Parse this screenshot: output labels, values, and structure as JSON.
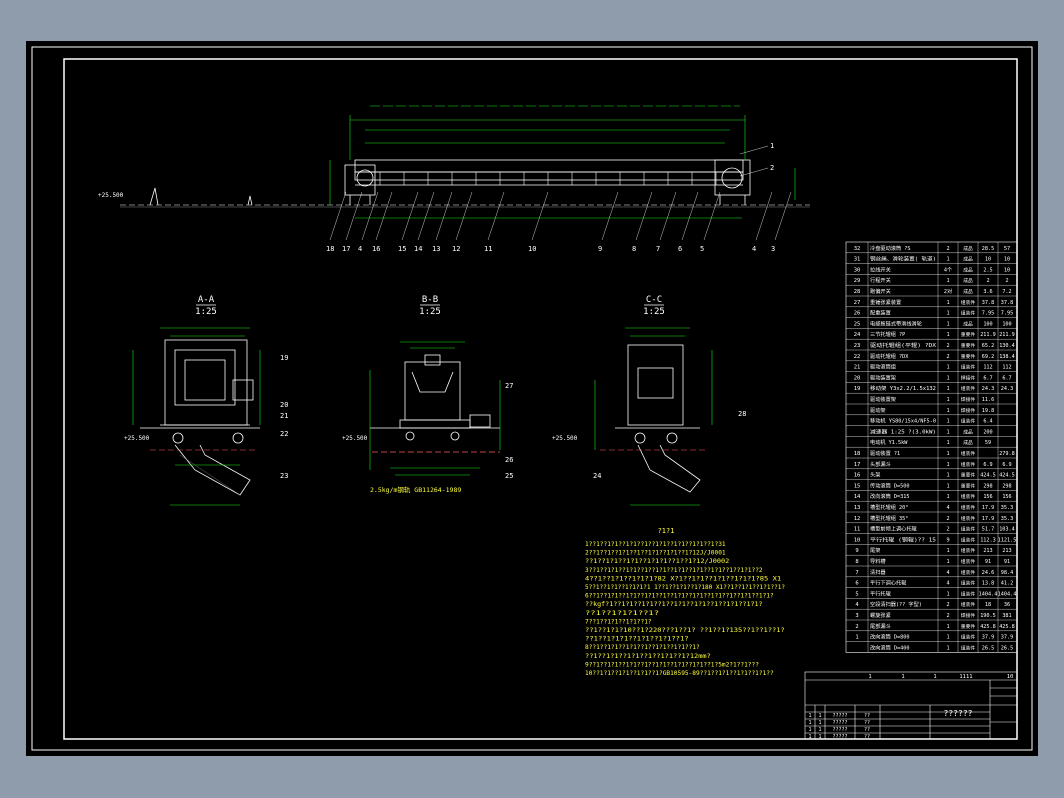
{
  "colors": {
    "backdrop": "#8f9cab",
    "sheet": "#000000",
    "frame": "#ffffff",
    "drawing": "#ffffff",
    "dims": "#19e619",
    "table_text": "#ffffff",
    "accent": "#ff5a5a",
    "notes": "#ffff3c"
  },
  "views": {
    "section_a": {
      "title": "A-A",
      "scale": "1:25"
    },
    "section_b": {
      "title": "B-B",
      "scale": "1:25"
    },
    "section_c": {
      "title": "C-C",
      "scale": "1:25"
    }
  },
  "elevation_label": "+25.500",
  "section_note": "2.5kg/m钢轨 GB11264-1989",
  "callouts_bottom": [
    "18",
    "17",
    "4",
    "16",
    "15",
    "14",
    "13",
    "12",
    "11",
    "10",
    "9",
    "8",
    "7",
    "6",
    "5",
    "4",
    "3"
  ],
  "callouts_side": [
    "1",
    "2"
  ],
  "callouts_a": [
    "19",
    "20",
    "21",
    "22",
    "23"
  ],
  "callouts_b": [
    "27",
    "26",
    "25"
  ],
  "callouts_c": [
    "28",
    "24"
  ],
  "notes": {
    "heading": "?1?1",
    "lines": [
      "1??1??1?1??1?1??1??1?1??1?1??1?1??1?31",
      "2??1??1??1?1??1??1?1??1?1??1?12J/J0001",
      "    ??1??1?1??1?1??1?1?1??1??1?12/J0002",
      "3??1??1?1??1?1??1??1?1??1?1??1?1??1?1??1??1?1??2",
      "4??1??1?1??1?1?1?82    X?1??1?1??1?1??1?1?1?85     X1",
      "5??1??1?1??1?1?1?1     1??1??1?1??1?180     X1??1??1?1??1?1??1?",
      "6??1??1?1??1?1??1?1??1??1?1??1?1??1?1??1??1?1??1?1?",
      "    ??kgf?1??1?1??1?1??1??1?1??1?1??1??1?1??1?1?",
      "      ??1??1?1?1??1?",
      "7??1??1?1??1?1??1?",
      "    ??1??1?1?10??1?220???1??1?    ??1??1?135??1??1??1?",
      "    ??1??1?1?1??1?1??1?1??1?",
      "8??1??1?1??1?1??1??1?1??1?1??1?",
      "    ??1??1?1??1?1??1??1?1??1?12mm?",
      "9??1??1?1??1?1??1??1?1??1?1??1?1??1?5m2?1??1???",
      "10??1?1??1?1??1?1??1?GB10595-89??1??1?1??1?1??1?1??"
    ]
  },
  "parts_table": {
    "rows": [
      [
        "32",
        "冷盘驱动滚筒 ?S",
        "2",
        "成品",
        "28.5",
        "57"
      ],
      [
        "31",
        "钢丝绳、滑轮装置( 轨道)",
        "1",
        "成品",
        "10",
        "10"
      ],
      [
        "30",
        "拉线开关",
        "4个",
        "成品",
        "2.5",
        "10"
      ],
      [
        "29",
        "行程开关",
        "1",
        "成品",
        "2",
        "2"
      ],
      [
        "28",
        "跑偏开关",
        "2对",
        "成品",
        "3.6",
        "7.2"
      ],
      [
        "27",
        "重锤张紧装置",
        "1",
        "组装件",
        "37.8",
        "37.8"
      ],
      [
        "26",
        "配重装置",
        "1",
        "组装件",
        "7.95",
        "7.95"
      ],
      [
        "25",
        "电缆拖链式带滑线滑轮",
        "1",
        "成品",
        "100",
        "100"
      ],
      [
        "24",
        "三节托辊组 ?P",
        "1",
        "重要件",
        "211.9",
        "211.9"
      ],
      [
        "23",
        "驱动托辊组(平辊) ?DX",
        "2",
        "重要件",
        "65.2",
        "130.4"
      ],
      [
        "22",
        "驱动托辊组 ?DX",
        "2",
        "重要件",
        "69.2",
        "138.4"
      ],
      [
        "21",
        "驱动滚筒组",
        "1",
        "组装件",
        "112",
        "112"
      ],
      [
        "20",
        "驱动装置架",
        "1",
        "焊接件",
        "6.7",
        "6.7"
      ],
      [
        "19",
        "移动架 Y3x2.2/1.5x132",
        "1",
        "组装件",
        "24.3",
        "24.3"
      ],
      [
        "",
        "驱动装置架",
        "1",
        "焊接件",
        "11.6",
        ""
      ],
      [
        "",
        "驱动架",
        "1",
        "焊接件",
        "19.8",
        ""
      ],
      [
        "",
        "移动机 YS80/15x4/NF5-0",
        "1",
        "组装件",
        "6.4",
        ""
      ],
      [
        "",
        "减速器 1:25 ?(3.0kW)",
        "1",
        "成品",
        "200",
        ""
      ],
      [
        "",
        "电动机 Y1.5kW",
        "1",
        "成品",
        "59",
        ""
      ],
      [
        "18",
        "驱动装置 ?1",
        "1",
        "组装件",
        "",
        "279.8"
      ],
      [
        "17",
        "头部漏斗",
        "1",
        "组装件",
        "6.9",
        "6.9"
      ],
      [
        "16",
        "头架",
        "1",
        "重要件",
        "424.5",
        "424.5"
      ],
      [
        "15",
        "传动滚筒 D=500",
        "1",
        "重要件",
        "298",
        "298"
      ],
      [
        "14",
        "改向滚筒 D=315",
        "1",
        "组装件",
        "156",
        "156"
      ],
      [
        "13",
        "槽型托辊组 20°",
        "4",
        "组装件",
        "17.9",
        "35.3"
      ],
      [
        "12",
        "槽型托辊组 35°",
        "2",
        "组装件",
        "17.9",
        "35.3"
      ],
      [
        "11",
        "槽型前倾上调心托辊",
        "2",
        "组装件",
        "51.7",
        "103.4"
      ],
      [
        "10",
        "平行托辊 (钢辊)?? 15",
        "9",
        "组装件",
        "112.3",
        "1121.5"
      ],
      [
        "9",
        "尾架",
        "1",
        "组装件",
        "213",
        "213"
      ],
      [
        "8",
        "导料槽",
        "1",
        "组装件",
        "91",
        "91"
      ],
      [
        "7",
        "清扫器",
        "4",
        "组装件",
        "24.6",
        "98.4"
      ],
      [
        "6",
        "平行下调心托辊",
        "4",
        "组装件",
        "13.8",
        "41.2"
      ],
      [
        "5",
        "平行托辊",
        "1",
        "组装件",
        "1404.4",
        "1404.4"
      ],
      [
        "4",
        "空段清扫器(?? 字型)",
        "2",
        "组装件",
        "18",
        "36"
      ],
      [
        "3",
        "螺旋张紧",
        "2",
        "焊接件",
        "190.5",
        "381"
      ],
      [
        "2",
        "尾部漏斗",
        "1",
        "重要件",
        "425.8",
        "425.8"
      ],
      [
        "1",
        "改向滚筒 D=800",
        "1",
        "组装件",
        "37.9",
        "37.9"
      ],
      [
        "",
        "改向滚筒 D=400",
        "1",
        "组装件",
        "26.5",
        "26.5"
      ]
    ]
  },
  "title_block": {
    "header_cells": [
      "1",
      "1",
      "1",
      "1111",
      "10"
    ],
    "title": "??????",
    "row_cells": [
      "1",
      "1",
      "?????",
      "??"
    ]
  }
}
